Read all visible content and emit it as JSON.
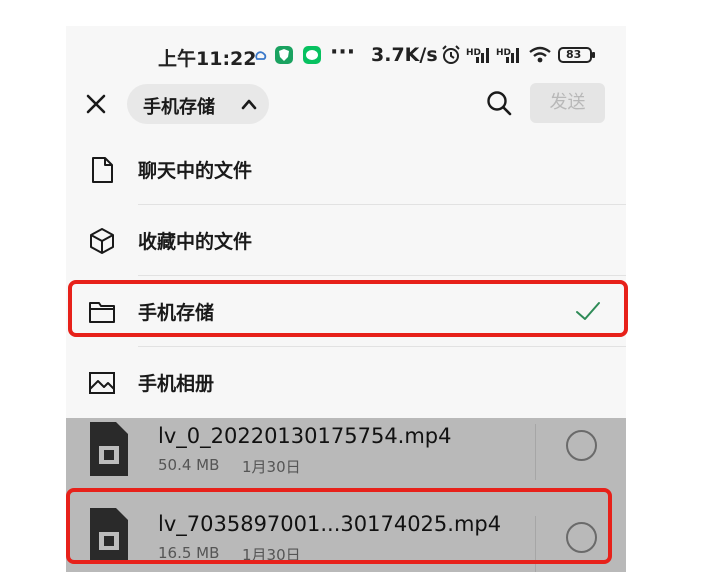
{
  "status_bar": {
    "time": "上午11:22",
    "overflow": "···",
    "speed": "3.7K/s",
    "battery": "83",
    "icons": [
      "cloud-icon",
      "shield-app-icon",
      "wechat-icon",
      "alarm-icon",
      "signal-icon",
      "signal-icon",
      "wifi-icon",
      "battery-icon"
    ]
  },
  "header": {
    "location_label": "手机存储",
    "send_label": "发送",
    "icons": [
      "close-icon",
      "chevron-up-icon",
      "search-icon"
    ]
  },
  "menu": {
    "items": [
      {
        "label": "聊天中的文件",
        "icon": "document-icon"
      },
      {
        "label": "收藏中的文件",
        "icon": "cube-icon"
      },
      {
        "label": "手机存储",
        "icon": "folder-icon",
        "selected": true
      },
      {
        "label": "手机相册",
        "icon": "image-icon"
      }
    ]
  },
  "files": [
    {
      "name": "lv_0_20220130175754.mp4",
      "size": "50.4 MB",
      "date": "1月30日",
      "icon": "video-file-icon"
    },
    {
      "name": "lv_7035897001...30174025.mp4",
      "size": "16.5 MB",
      "date": "1月30日",
      "icon": "video-file-icon"
    }
  ],
  "colors": {
    "highlight_border": "#e7211a",
    "check": "#2e8b57",
    "send_disabled_text": "#b8b8b8",
    "overlay_dim": "#b9b9b9"
  }
}
